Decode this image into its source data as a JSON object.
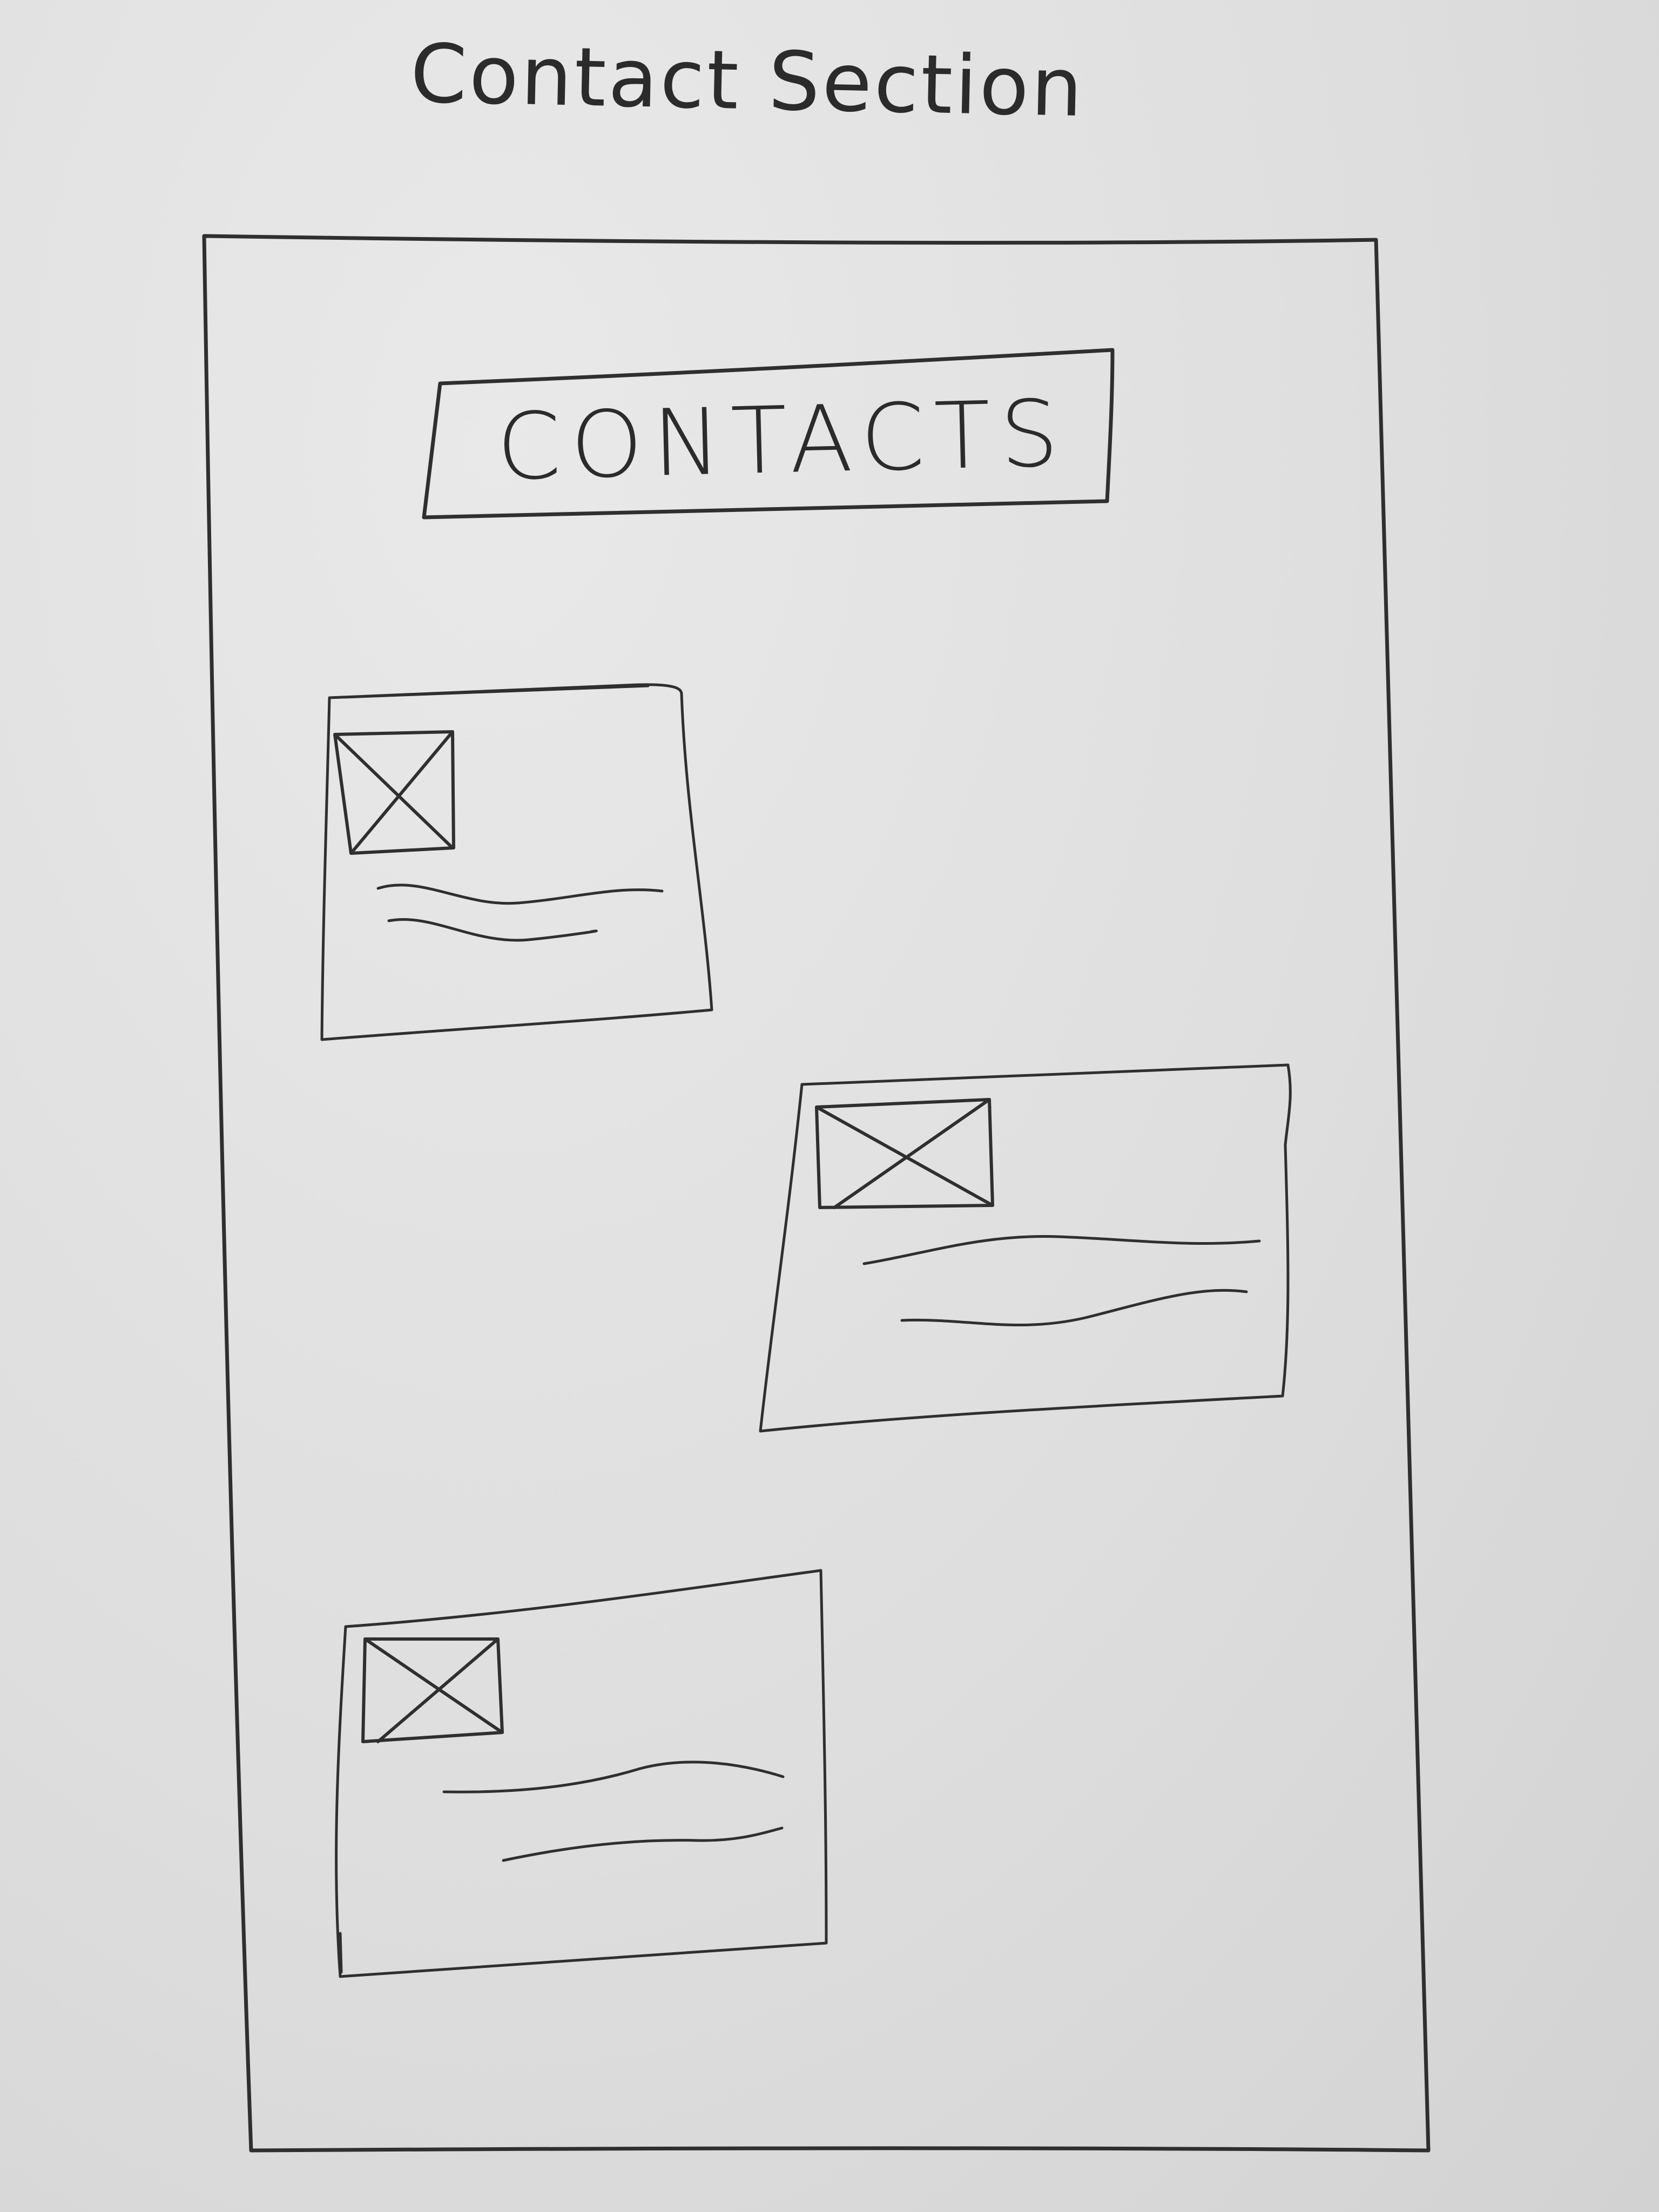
{
  "page": {
    "heading": "Contact Section"
  },
  "contacts_section": {
    "title": "CONTACTS",
    "cards": [
      {
        "position": "left",
        "thumbnail_icon": "image-placeholder-icon",
        "text_lines": 2
      },
      {
        "position": "right",
        "thumbnail_icon": "image-placeholder-icon",
        "text_lines": 2
      },
      {
        "position": "left",
        "thumbnail_icon": "image-placeholder-icon",
        "text_lines": 2
      }
    ]
  },
  "colors": {
    "ink": "#2f2f2f",
    "paper": "#dedede"
  }
}
